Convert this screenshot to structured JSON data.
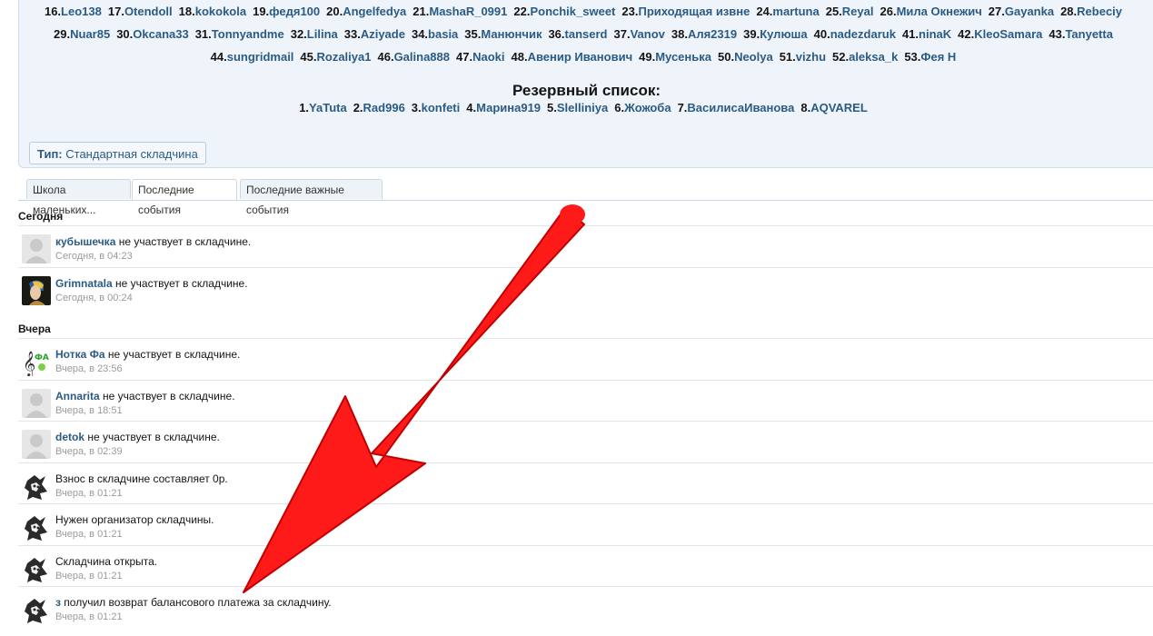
{
  "participants_row1": [
    {
      "num": "16.",
      "name": "Leo138"
    },
    {
      "num": "17.",
      "name": "Otendoll"
    },
    {
      "num": "18.",
      "name": "kokokola"
    },
    {
      "num": "19.",
      "name": "федя100"
    },
    {
      "num": "20.",
      "name": "Angelfedya"
    },
    {
      "num": "21.",
      "name": "MashaR_0991"
    },
    {
      "num": "22.",
      "name": "Ponchik_sweet"
    },
    {
      "num": "23.",
      "name": "Приходящая извне"
    },
    {
      "num": "24.",
      "name": "martuna"
    },
    {
      "num": "25.",
      "name": "Reyal"
    },
    {
      "num": "26.",
      "name": "Мила Окнежич"
    },
    {
      "num": "27.",
      "name": "Gayanka"
    },
    {
      "num": "28.",
      "name": "Rebeciy"
    }
  ],
  "participants_row2": [
    {
      "num": "29.",
      "name": "Nuar85"
    },
    {
      "num": "30.",
      "name": "Okcana33"
    },
    {
      "num": "31.",
      "name": "Tonnyandme"
    },
    {
      "num": "32.",
      "name": "Lilina"
    },
    {
      "num": "33.",
      "name": "Aziyade"
    },
    {
      "num": "34.",
      "name": "basia"
    },
    {
      "num": "35.",
      "name": "Манюнчик"
    },
    {
      "num": "36.",
      "name": "tanserd"
    },
    {
      "num": "37.",
      "name": "Vanov"
    },
    {
      "num": "38.",
      "name": "Аля2319"
    },
    {
      "num": "39.",
      "name": "Кулюша"
    },
    {
      "num": "40.",
      "name": "nadezdaruk"
    },
    {
      "num": "41.",
      "name": "ninaK"
    },
    {
      "num": "42.",
      "name": "KleoSamara"
    },
    {
      "num": "43.",
      "name": "Tanyetta"
    }
  ],
  "participants_row3": [
    {
      "num": "44.",
      "name": "sungridmail"
    },
    {
      "num": "45.",
      "name": "Rozaliya1"
    },
    {
      "num": "46.",
      "name": "Galina888"
    },
    {
      "num": "47.",
      "name": "Naoki"
    },
    {
      "num": "48.",
      "name": "Авенир Иванович"
    },
    {
      "num": "49.",
      "name": "Мусенька"
    },
    {
      "num": "50.",
      "name": "Neolya"
    },
    {
      "num": "51.",
      "name": "vizhu"
    },
    {
      "num": "52.",
      "name": "aleksa_k"
    },
    {
      "num": "53.",
      "name": "Фея Н"
    }
  ],
  "reserve_title": "Резервный список:",
  "reserve": [
    {
      "num": "1.",
      "name": "YaTuta"
    },
    {
      "num": "2.",
      "name": "Rad996"
    },
    {
      "num": "3.",
      "name": "konfeti"
    },
    {
      "num": "4.",
      "name": "Марина919"
    },
    {
      "num": "5.",
      "name": "Slelliniya"
    },
    {
      "num": "6.",
      "name": "Жожоба"
    },
    {
      "num": "7.",
      "name": "ВасилисаИванова"
    },
    {
      "num": "8.",
      "name": "AQVAREL"
    }
  ],
  "type_label": "Тип:",
  "type_value": "Стандартная складчина",
  "tabs": [
    {
      "label": "Школа маленьких..."
    },
    {
      "label": "Последние события"
    },
    {
      "label": "Последние важные события"
    }
  ],
  "day_today": "Сегодня",
  "day_yesterday": "Вчера",
  "events_today": [
    {
      "user": "кубышечка",
      "text": " не участвует в складчине.",
      "time": "Сегодня, в 04:23",
      "avatar": "default-avatar-icon"
    },
    {
      "user": "Grimnatala",
      "text": " не участвует в складчине.",
      "time": "Сегодня, в 00:24",
      "avatar": "girl-pearl-avatar-icon"
    }
  ],
  "events_yesterday": [
    {
      "user": "Нотка Фа",
      "text": " не участвует в складчине.",
      "time": "Вчера, в 23:56",
      "avatar": "treble-clef-avatar-icon"
    },
    {
      "user": "Annarita",
      "text": " не участвует в складчине.",
      "time": "Вчера, в 18:51",
      "avatar": "default-avatar-icon"
    },
    {
      "user": "detok",
      "text": " не участвует в складчине.",
      "time": "Вчера, в 02:39",
      "avatar": "default-avatar-icon"
    },
    {
      "user": "",
      "text": "Взнос в складчине составляет 0р.",
      "time": "Вчера, в 01:21",
      "avatar": "robot-avatar-icon"
    },
    {
      "user": "",
      "text": "Нужен организатор складчины.",
      "time": "Вчера, в 01:21",
      "avatar": "robot-avatar-icon"
    },
    {
      "user": "",
      "text": "Складчина открыта.",
      "time": "Вчера, в 01:21",
      "avatar": "robot-avatar-icon"
    },
    {
      "user": "з",
      "text": " получил возврат балансового платежа за складчину.",
      "time": "Вчера, в 01:21",
      "avatar": "robot-avatar-icon"
    }
  ],
  "colors": {
    "link": "#2b5b84",
    "arrow": "#ff1a1a",
    "panel_bg": "#eef4fa"
  }
}
